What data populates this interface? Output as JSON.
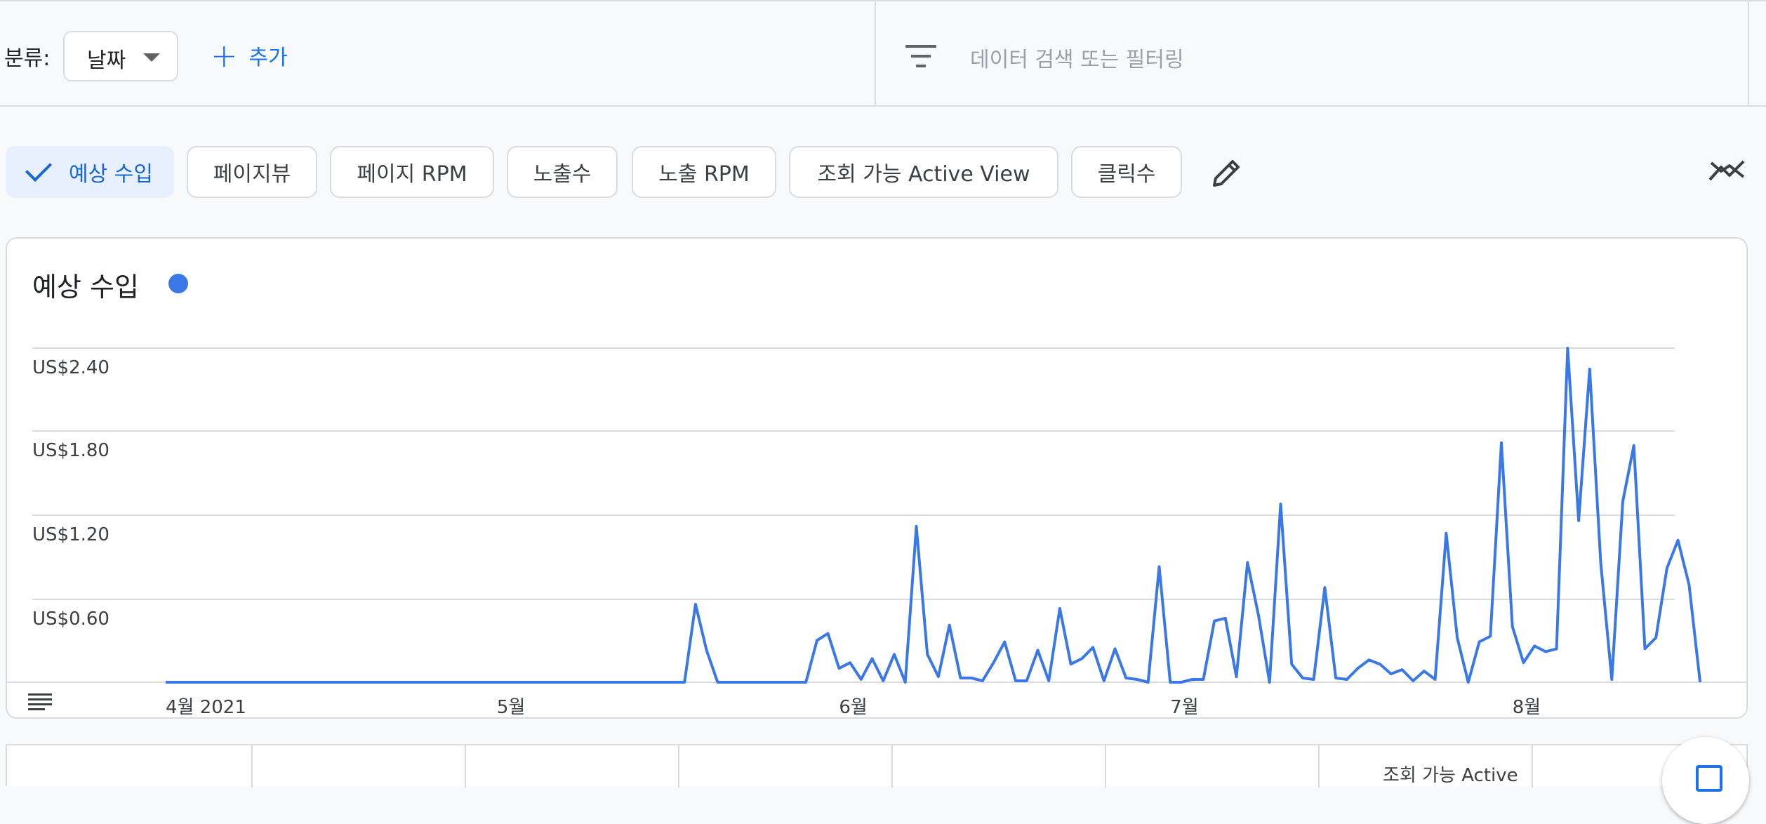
{
  "toolbar": {
    "category_label": "분류:",
    "category_value": "날짜",
    "add_label": "추가",
    "search_placeholder": "데이터 검색 또는 필터링"
  },
  "metrics": [
    {
      "label": "예상 수입",
      "active": true
    },
    {
      "label": "페이지뷰",
      "active": false
    },
    {
      "label": "페이지 RPM",
      "active": false
    },
    {
      "label": "노출수",
      "active": false
    },
    {
      "label": "노출 RPM",
      "active": false
    },
    {
      "label": "조회 가능 Active View",
      "active": false
    },
    {
      "label": "클릭수",
      "active": false
    }
  ],
  "icons": {
    "edit": "pencil-icon",
    "compare": "trend-compare-icon",
    "filter": "filter-icon",
    "legend": "list-icon"
  },
  "colors": {
    "series": "#3b78e7",
    "accent": "#1a73e8",
    "active_chip_bg": "#e8f0fe"
  },
  "card": {
    "title": "예상 수입"
  },
  "table": {
    "partial_header": "조회 가능 Active"
  },
  "chart_data": {
    "type": "line",
    "title": "예상 수입",
    "y_ticks": [
      {
        "value": 0.6,
        "label": "US$0.60"
      },
      {
        "value": 1.2,
        "label": "US$1.20"
      },
      {
        "value": 1.8,
        "label": "US$1.80"
      },
      {
        "value": 2.4,
        "label": "US$2.40"
      }
    ],
    "x_ticks": [
      {
        "date": "2021-04-01",
        "label": "4월 2021"
      },
      {
        "date": "2021-05-01",
        "label": "5월"
      },
      {
        "date": "2021-06-01",
        "label": "6월"
      },
      {
        "date": "2021-07-01",
        "label": "7월"
      },
      {
        "date": "2021-08-01",
        "label": "8월"
      }
    ],
    "ylim": [
      0,
      2.4
    ],
    "x_range": [
      "2021-04-01",
      "2021-08-11"
    ],
    "grid": true,
    "series": [
      {
        "start_date": "2021-04-01",
        "values": [
          0,
          0,
          0,
          0,
          0,
          0,
          0,
          0,
          0,
          0,
          0,
          0,
          0,
          0,
          0,
          0,
          0,
          0,
          0,
          0,
          0,
          0,
          0,
          0,
          0,
          0,
          0,
          0,
          0,
          0,
          0,
          0,
          0,
          0,
          0,
          0,
          0,
          0,
          0,
          0,
          0,
          0,
          0,
          0,
          0,
          0,
          0,
          0,
          0.56,
          0.23,
          0,
          0,
          0,
          0,
          0,
          0,
          0,
          0,
          0,
          0.3,
          0.35,
          0.1,
          0.14,
          0.02,
          0.17,
          0.01,
          0.2,
          0,
          1.12,
          0.2,
          0.04,
          0.41,
          0.03,
          0.03,
          0.01,
          0.14,
          0.29,
          0.01,
          0.01,
          0.23,
          0.01,
          0.53,
          0.13,
          0.17,
          0.25,
          0.01,
          0.24,
          0.03,
          0.02,
          0,
          0.83,
          0,
          0,
          0.02,
          0.02,
          0.44,
          0.46,
          0.04,
          0.86,
          0.48,
          0,
          1.28,
          0.13,
          0.03,
          0.02,
          0.68,
          0.03,
          0.02,
          0.1,
          0.16,
          0.13,
          0.06,
          0.09,
          0.01,
          0.08,
          0.02,
          1.07,
          0.32,
          0,
          0.29,
          0.33,
          1.72,
          0.4,
          0.14,
          0.26,
          0.22,
          0.24,
          2.4,
          1.16,
          2.25,
          0.86,
          0.02,
          1.3,
          1.7,
          0.24,
          0.32,
          0.82,
          1.02,
          0.7,
          0
        ]
      }
    ]
  }
}
